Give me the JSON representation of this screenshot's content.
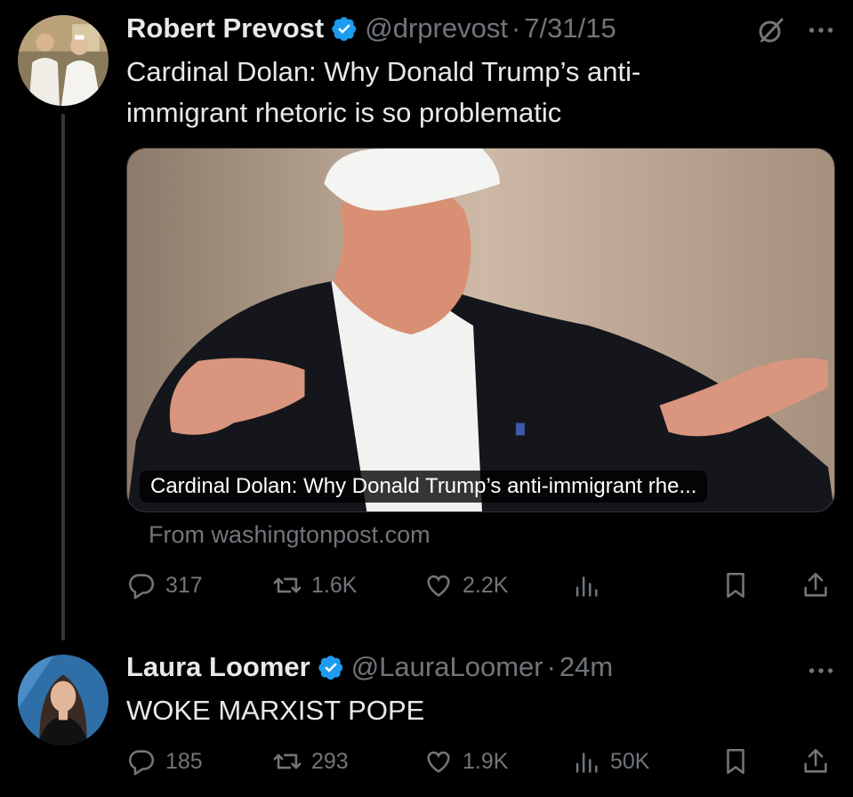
{
  "tweets": [
    {
      "author": "Robert Prevost",
      "handle": "@drprevost",
      "separator": "·",
      "time": "7/31/15",
      "text_lines": [
        "Cardinal Dolan: Why Donald Trump’s anti-",
        "immigrant rhetoric is so problematic"
      ],
      "card": {
        "caption": "Cardinal Dolan: Why Donald Trump’s anti-immigrant rhe...",
        "source": "From washingtonpost.com"
      },
      "stats": {
        "replies": "317",
        "retweets": "1.6K",
        "likes": "2.2K",
        "views": ""
      },
      "icons": {
        "top_right": [
          "grok-icon",
          "more-icon"
        ]
      }
    },
    {
      "author": "Laura Loomer",
      "handle": "@LauraLoomer",
      "separator": "·",
      "time": "24m",
      "text_lines": [
        "WOKE MARXIST POPE"
      ],
      "stats": {
        "replies": "185",
        "retweets": "293",
        "likes": "1.9K",
        "views": "50K"
      },
      "icons": {
        "top_right": [
          "more-icon"
        ]
      }
    }
  ],
  "colors": {
    "background": "#000000",
    "text": "#e7e9ea",
    "muted": "#71767b",
    "verified": "#1d9bf0",
    "thread_line": "#333639"
  }
}
